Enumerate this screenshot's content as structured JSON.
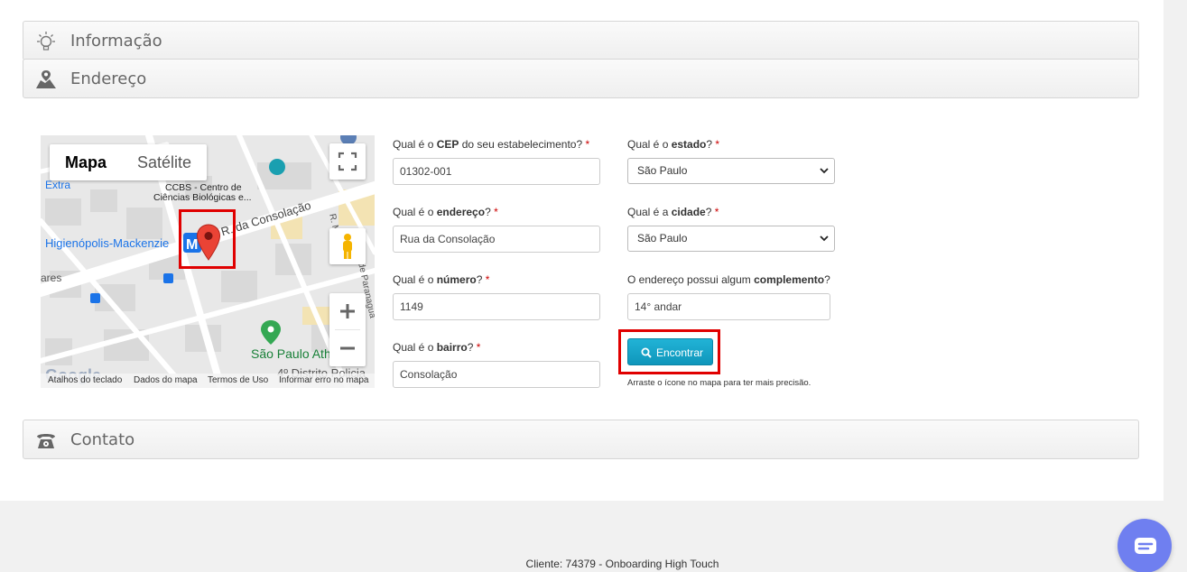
{
  "sections": {
    "info": {
      "title": "Informação",
      "icon": "lightbulb-icon"
    },
    "address": {
      "title": "Endereço",
      "icon": "map-location-icon"
    },
    "contact": {
      "title": "Contato",
      "icon": "telephone-icon"
    }
  },
  "map": {
    "type_map": "Mapa",
    "type_satellite": "Satélite",
    "labels": {
      "extra": "Extra",
      "ccbs1": "CCBS - Centro de",
      "ccbs2": "Ciências Biológicas e...",
      "station": "Higienópolis-Mackenzie",
      "street": "R. da Consolação",
      "street2": "R. Maria",
      "street3": "de Paranaguá",
      "ares": "ares",
      "saopaulo": "São Paulo Ath",
      "distrito": "4º Distrito Policia"
    },
    "footer": {
      "shortcuts": "Atalhos do teclado",
      "data": "Dados do mapa",
      "terms": "Termos de Uso",
      "report": "Informar erro no mapa"
    },
    "colors": {
      "marker": "#ea4335",
      "highlight": "#e00000"
    }
  },
  "form": {
    "cep": {
      "pre": "Qual é o ",
      "bold": "CEP",
      "post": " do seu estabelecimento?",
      "value": "01302-001"
    },
    "estado": {
      "pre": "Qual é o ",
      "bold": "estado",
      "post": "?",
      "value": "São Paulo"
    },
    "endereco": {
      "pre": "Qual é o ",
      "bold": "endereço",
      "post": "?",
      "value": "Rua da Consolação"
    },
    "cidade": {
      "pre": "Qual é a ",
      "bold": "cidade",
      "post": "?",
      "value": "São Paulo"
    },
    "numero": {
      "pre": "Qual é o ",
      "bold": "número",
      "post": "?",
      "value": "1149"
    },
    "complemento": {
      "pre": "O endereço possui algum ",
      "bold": "complemento",
      "post": "?",
      "value": "14° andar"
    },
    "bairro": {
      "pre": "Qual é o ",
      "bold": "bairro",
      "post": "?",
      "value": "Consolação"
    },
    "required_mark": "*",
    "find_button": "Encontrar",
    "hint": "Arraste o ícone no mapa para ter mais precisão.",
    "accent": "#17a2c8"
  },
  "footer_text": "Cliente: 74379 - Onboarding High Touch",
  "chat_color": "#6f7ff0"
}
